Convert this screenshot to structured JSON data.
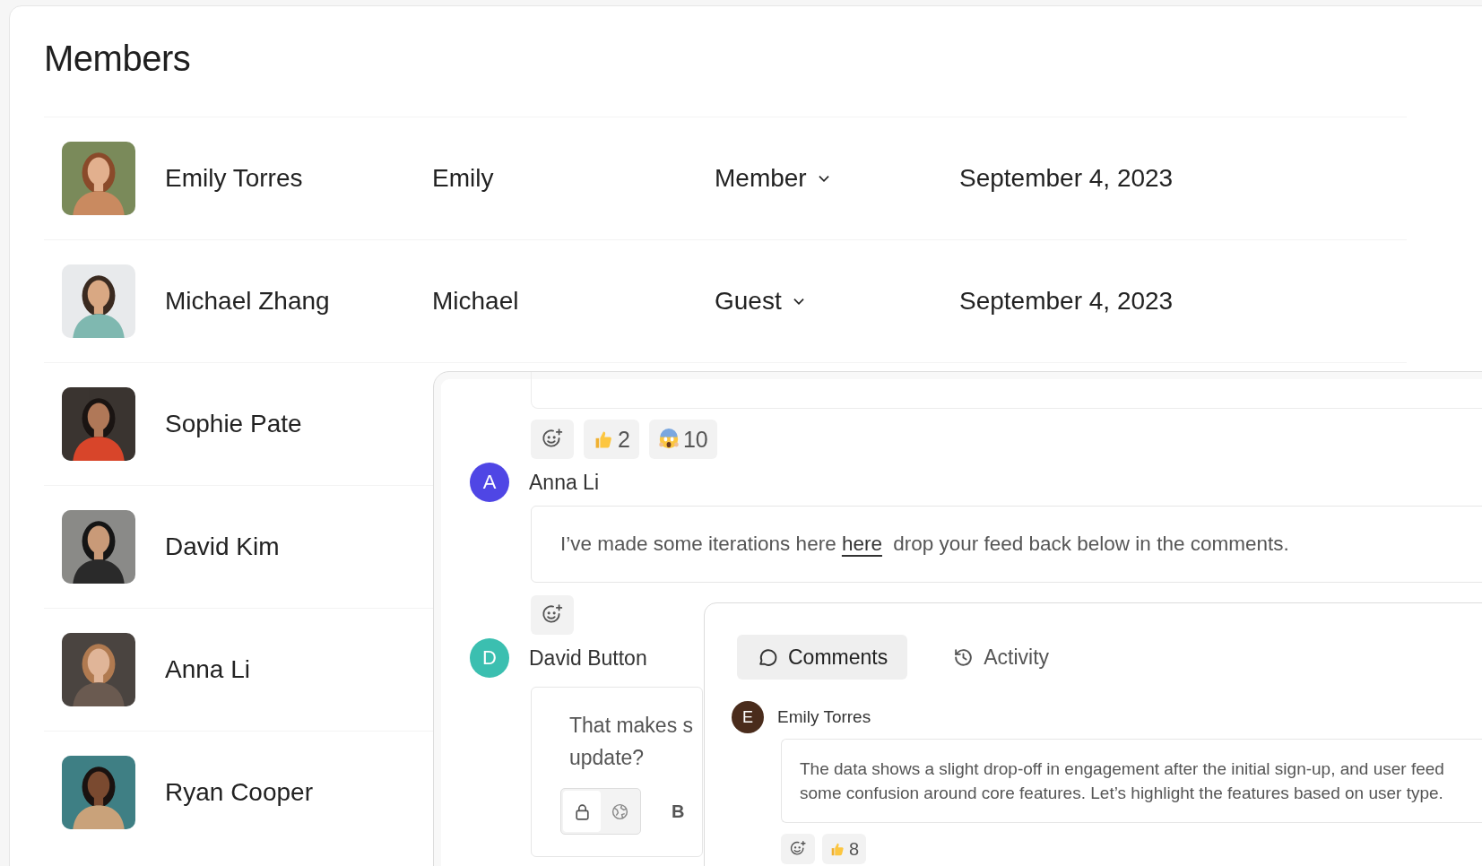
{
  "title": "Members",
  "members": [
    {
      "kind": "picture",
      "name": "Emily Torres",
      "nickname": "Emily",
      "role": "Member",
      "joined": "September 4, 2023"
    },
    {
      "kind": "picture",
      "name": "Michael Zhang",
      "nickname": "Michael",
      "role": "Guest",
      "joined": "September 4, 2023"
    },
    {
      "kind": "picture",
      "name": "Sophie Pate"
    },
    {
      "kind": "picture",
      "name": "David Kim"
    },
    {
      "kind": "picture",
      "name": "Anna Li"
    },
    {
      "kind": "picture",
      "name": "Ryan Cooper"
    }
  ],
  "thread": {
    "top_reactions": [
      {
        "kind": "thumbs",
        "count": "2"
      },
      {
        "kind": "scream",
        "count": "10"
      }
    ],
    "comments": [
      {
        "initial": "A",
        "author": "Anna Li",
        "color": "#4f46e5",
        "before": "I’ve made some iterations here",
        "link": "here",
        "after": "drop your feed back below in the comments."
      },
      {
        "initial": "D",
        "author": "David Button",
        "color": "#3bbfb0",
        "lines": [
          "That makes s",
          "update?"
        ],
        "bold_label": "B",
        "locked": true
      }
    ]
  },
  "comments_panel": {
    "tabs": [
      {
        "label": "Comments",
        "kind": "comments",
        "selected": true
      },
      {
        "label": "Activity",
        "kind": "activity",
        "selected": false
      }
    ],
    "comment": {
      "initial": "E",
      "author": "Emily Torres",
      "color": "#4a2c1c",
      "lines": [
        "The data shows a slight drop-off in engagement after the initial sign-up, and user feed",
        "some confusion around core features. Let’s highlight the features based on user type."
      ],
      "reactions": [
        {
          "kind": "thumbs",
          "count": "8"
        }
      ]
    }
  }
}
